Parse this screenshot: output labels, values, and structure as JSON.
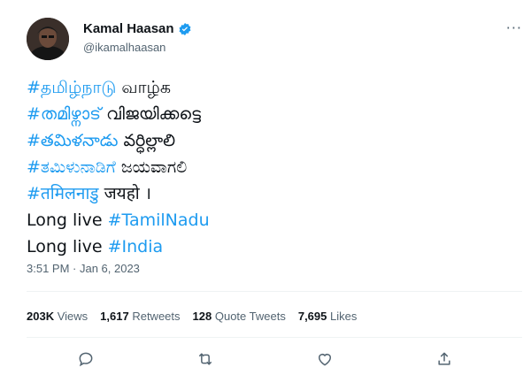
{
  "author": {
    "name": "Kamal Haasan",
    "handle": "@ikamalhaasan",
    "verified_color": "#1d9bf0"
  },
  "more_label": "···",
  "tweet_lines": [
    {
      "hashtag": "#தமிழ்நாடு",
      "rest": " வாழ்க"
    },
    {
      "hashtag": "#തമിഴ്നാട്",
      "rest": " വിജയിക്കട്ടെ"
    },
    {
      "hashtag": "#తమిళనాడు",
      "rest": " వర్ధిల్లాలి"
    },
    {
      "hashtag": "#ತಮಿಳುನಾಡಿಗೆ",
      "rest": " ಜಯವಾಗಲಿ"
    },
    {
      "hashtag": "#तमिलनाडु",
      "rest": " जयहो ।"
    },
    {
      "prefix": "Long live ",
      "hashtag": "#TamilNadu"
    },
    {
      "prefix": "Long live ",
      "hashtag": "#India"
    }
  ],
  "timestamp": "3:51 PM · Jan 6, 2023",
  "stats": {
    "views_count": "203K",
    "views_label": "Views",
    "retweets_count": "1,617",
    "retweets_label": "Retweets",
    "quotes_count": "128",
    "quotes_label": "Quote Tweets",
    "likes_count": "7,695",
    "likes_label": "Likes"
  },
  "actions": [
    "reply-icon",
    "retweet-icon",
    "like-icon",
    "share-icon"
  ],
  "colors": {
    "link": "#1d9bf0",
    "text": "#0f1419",
    "muted": "#536471"
  }
}
